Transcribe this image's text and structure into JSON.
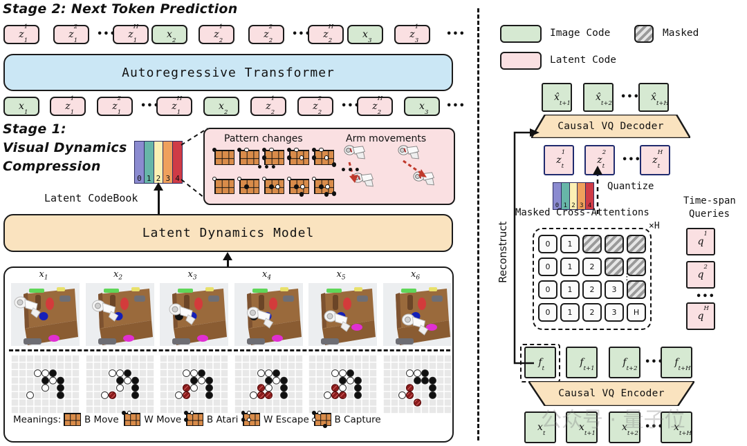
{
  "stage2": {
    "title": "Stage 2: Next Token Prediction",
    "transformer_label": "Autoregressive Transformer",
    "input_row": [
      {
        "text": "z",
        "sup": "1",
        "sub": "1",
        "type": "latent"
      },
      {
        "text": "z",
        "sup": "2",
        "sub": "1",
        "type": "latent"
      },
      {
        "text": "•••",
        "type": "ellipsis"
      },
      {
        "text": "z",
        "sup": "H",
        "sub": "1",
        "type": "latent"
      },
      {
        "text": "x",
        "sup": "",
        "sub": "2",
        "type": "image"
      },
      {
        "text": "z",
        "sup": "1",
        "sub": "2",
        "type": "latent"
      },
      {
        "text": "z",
        "sup": "2",
        "sub": "2",
        "type": "latent"
      },
      {
        "text": "•••",
        "type": "ellipsis"
      },
      {
        "text": "z",
        "sup": "H",
        "sub": "2",
        "type": "latent"
      },
      {
        "text": "x",
        "sup": "",
        "sub": "3",
        "type": "image"
      },
      {
        "text": "z",
        "sup": "1",
        "sub": "3",
        "type": "latent"
      },
      {
        "text": "•••",
        "type": "ellipsis"
      }
    ],
    "output_row": [
      {
        "text": "x",
        "sup": "",
        "sub": "1",
        "type": "image"
      },
      {
        "text": "z",
        "sup": "1",
        "sub": "1",
        "type": "latent"
      },
      {
        "text": "z",
        "sup": "2",
        "sub": "1",
        "type": "latent"
      },
      {
        "text": "•••",
        "type": "ellipsis"
      },
      {
        "text": "z",
        "sup": "H",
        "sub": "1",
        "type": "latent"
      },
      {
        "text": "x",
        "sup": "",
        "sub": "2",
        "type": "image"
      },
      {
        "text": "z",
        "sup": "1",
        "sub": "2",
        "type": "latent"
      },
      {
        "text": "z",
        "sup": "2",
        "sub": "2",
        "type": "latent"
      },
      {
        "text": "•••",
        "type": "ellipsis"
      },
      {
        "text": "z",
        "sup": "H",
        "sub": "2",
        "type": "latent"
      },
      {
        "text": "x",
        "sup": "",
        "sub": "3",
        "type": "image"
      },
      {
        "text": "•••",
        "type": "ellipsis"
      }
    ]
  },
  "stage1": {
    "title_line1": "Stage 1:",
    "title_line2": "Visual Dynamics",
    "title_line3": "Compression",
    "codebook_label": "Latent CodeBook",
    "codebook_entries": [
      "0",
      "1",
      "2",
      "3",
      "4"
    ],
    "codebook_colors": [
      "#8b8bd0",
      "#67b6a8",
      "#fcf0b4",
      "#efa05c",
      "#cf3b46"
    ],
    "model_label": "Latent Dynamics Model",
    "callout": {
      "left_title": "Pattern changes",
      "right_title": "Arm movements",
      "ellipsis": "•••"
    }
  },
  "frames": {
    "labels": [
      "x",
      "x",
      "x",
      "x",
      "x",
      "x"
    ],
    "subs": [
      "1",
      "2",
      "3",
      "4",
      "5",
      "6"
    ],
    "meanings_label": "Meanings:",
    "meanings": [
      "B Move",
      "W Move",
      "B Atari",
      "W Escape",
      "B Capture"
    ]
  },
  "legend": {
    "image_code": "Image Code",
    "latent_code": "Latent Code",
    "masked": "Masked"
  },
  "right": {
    "decoder_label": "Causal VQ Decoder",
    "encoder_label": "Causal VQ Encoder",
    "reconstruct_label": "Reconstruct",
    "quantize_label": "Quantize",
    "masked_cross_attn_label": "Masked Cross-Attentions",
    "times_h": "×H",
    "timespan_line1": "Time-span",
    "timespan_line2": "Queries",
    "xhat_row": [
      {
        "text": "x̂",
        "sub": "t+1"
      },
      {
        "text": "x̂",
        "sub": "t+2"
      },
      {
        "text": "•••",
        "type": "ellipsis"
      },
      {
        "text": "x̂",
        "sub": "t+H"
      }
    ],
    "z_row": [
      {
        "text": "z",
        "sup": "1",
        "sub": "t"
      },
      {
        "text": "z",
        "sup": "2",
        "sub": "t"
      },
      {
        "text": "•••",
        "type": "ellipsis"
      },
      {
        "text": "z",
        "sup": "H",
        "sub": "t"
      }
    ],
    "f_row": [
      {
        "text": "f",
        "sub": "t"
      },
      {
        "text": "f",
        "sub": "t+1"
      },
      {
        "text": "f",
        "sub": "t+2"
      },
      {
        "text": "•••",
        "type": "ellipsis"
      },
      {
        "text": "f",
        "sub": "t+H"
      }
    ],
    "x_row": [
      {
        "text": "x",
        "sub": "t"
      },
      {
        "text": "x",
        "sub": "t+1"
      },
      {
        "text": "x",
        "sub": "t+2"
      },
      {
        "text": "•••",
        "type": "ellipsis"
      },
      {
        "text": "x",
        "sub": "t+H"
      }
    ],
    "queries": [
      {
        "text": "q",
        "sup": "1"
      },
      {
        "text": "•••",
        "type": "ellipsis"
      },
      {
        "text": "q",
        "sup": "2"
      },
      {
        "text": "q",
        "sup": "H"
      }
    ],
    "attn_grid": [
      [
        "0",
        "1",
        "M",
        "M",
        "M"
      ],
      [
        "0",
        "1",
        "2",
        "M",
        "M"
      ],
      [
        "0",
        "1",
        "2",
        "3",
        "M"
      ],
      [
        "0",
        "1",
        "2",
        "3",
        "H"
      ]
    ],
    "grid_vdots": "⋮"
  },
  "watermark": "公众号 · 量子位",
  "colors": {
    "latent": "#fae0e2",
    "image": "#d6e9d2",
    "transformer": "#cbe7f5",
    "model": "#fae3bf",
    "stroke": "#1a1a1a"
  }
}
